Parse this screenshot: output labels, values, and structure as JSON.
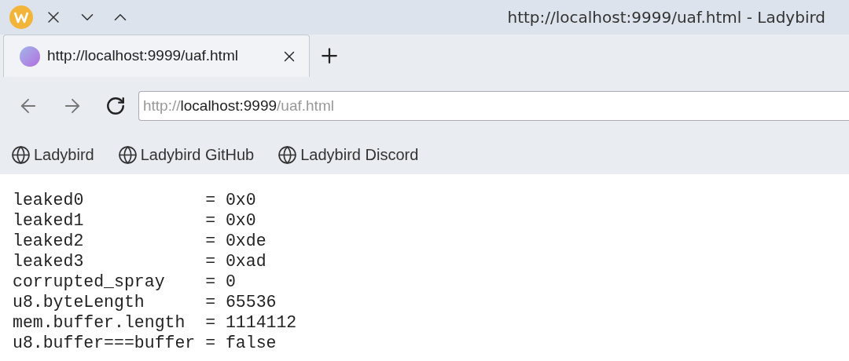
{
  "window": {
    "title": "http://localhost:9999/uaf.html - Ladybird"
  },
  "tabs": [
    {
      "label": "http://localhost:9999/uaf.html",
      "selected": true
    }
  ],
  "address_bar": {
    "url_parts": [
      {
        "text": "http://",
        "dim": true
      },
      {
        "text": "localhost:9999",
        "dim": false
      },
      {
        "text": "/uaf.html",
        "dim": true
      }
    ]
  },
  "bookmarks": [
    "Ladybird",
    "Ladybird GitHub",
    "Ladybird Discord"
  ],
  "page_lines": [
    "leaked0            = 0x0",
    "leaked1            = 0x0",
    "leaked2            = 0xde",
    "leaked3            = 0xad",
    "corrupted_spray    = 0",
    "u8.byteLength      = 65536",
    "mem.buffer.length  = 1114112",
    "u8.buffer===buffer = false"
  ]
}
